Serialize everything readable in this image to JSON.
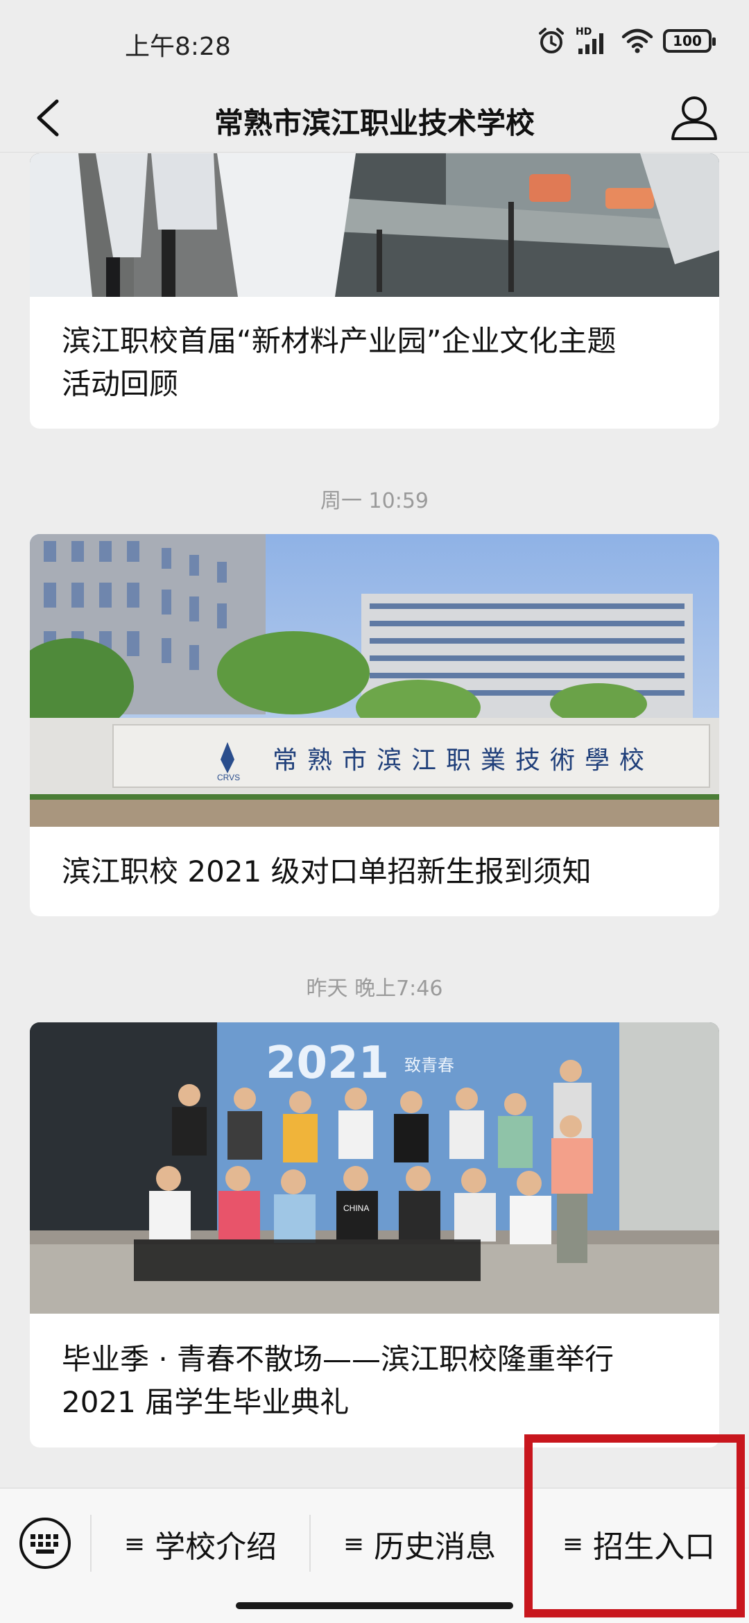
{
  "status_bar": {
    "time": "上午8:28",
    "network_label": "HD",
    "battery": "100"
  },
  "nav": {
    "title": "常熟市滨江职业技术学校"
  },
  "feed": {
    "articles": [
      {
        "title_line1": "滨江职校首届“新材料产业园”企业文化主题",
        "title_line2": "活动回顾"
      },
      {
        "timestamp": "周一 10:59",
        "title_line1": "滨江职校 2021 级对口单招新生报到须知",
        "sign_text": "常熟市滨江职業技術學校",
        "logo_text": "CRVS"
      },
      {
        "timestamp": "昨天 晚上7:46",
        "title_line1": "毕业季 · 青春不散场——滨江职校隆重举行",
        "title_line2": "2021 届学生毕业典礼",
        "banner_text": "2021",
        "banner_subtext": "致青春",
        "shirt_text": "CHINA"
      }
    ]
  },
  "bottom_menu": {
    "items": [
      {
        "label": "学校介绍",
        "icon": "≡"
      },
      {
        "label": "历史消息",
        "icon": "≡"
      },
      {
        "label": "招生入口",
        "icon": "≡"
      }
    ]
  },
  "colors": {
    "background": "#ededed",
    "highlight": "#c8161d",
    "timestamp": "#9a9a9a"
  }
}
